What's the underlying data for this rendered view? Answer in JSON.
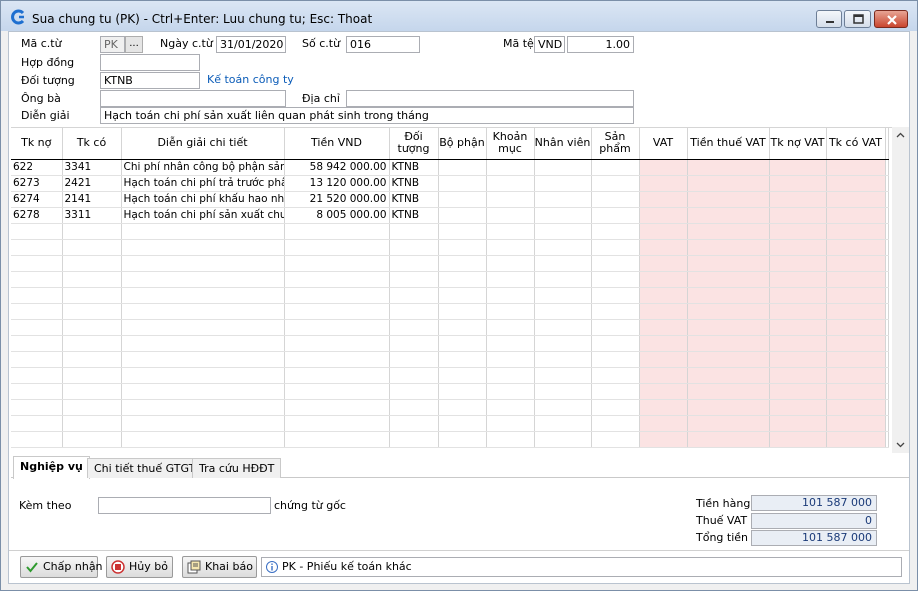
{
  "window": {
    "title": "Sua chung tu (PK) - Ctrl+Enter: Luu chung tu; Esc: Thoat"
  },
  "header": {
    "ma_ct_label": "Mã c.từ",
    "ma_ct_value": "PK",
    "ma_ct_btn": "...",
    "ngay_ct_label": "Ngày c.từ",
    "ngay_ct_value": "31/01/2020",
    "so_ct_label": "Số c.từ",
    "so_ct_value": "016",
    "ma_te_label": "Mã tệ",
    "ma_te_value": "VND",
    "ty_gia_value": "1.00",
    "hop_dong_label": "Hợp đồng",
    "hop_dong_value": "",
    "doi_tuong_label": "Đối tượng",
    "doi_tuong_value": "KTNB",
    "doi_tuong_name": "Kế toán công ty",
    "ong_ba_label": "Ông bà",
    "ong_ba_value": "",
    "dia_chi_label": "Địa chỉ",
    "dia_chi_value": "",
    "dien_giai_label": "Diễn giải",
    "dien_giai_value": "Hạch toán chi phí sản xuất liên quan phát sinh trong tháng"
  },
  "grid": {
    "columns": [
      "Tk nợ",
      "Tk có",
      "Diễn giải chi tiết",
      "Tiền VND",
      "Đối tượng",
      "Bộ phận",
      "Khoản mục",
      "Nhân viên",
      "Sản phẩm",
      "VAT",
      "Tiền thuế VAT",
      "Tk nợ VAT",
      "Tk có VAT"
    ],
    "rows": [
      [
        "622",
        "3341",
        "Chi phí nhân công bộ phận sản xu",
        "58 942 000.00",
        "KTNB",
        "",
        "",
        "",
        "",
        "",
        "",
        "",
        ""
      ],
      [
        "6273",
        "2421",
        "Hạch toán chi phí trả trước phân",
        "13 120 000.00",
        "KTNB",
        "",
        "",
        "",
        "",
        "",
        "",
        "",
        ""
      ],
      [
        "6274",
        "2141",
        "Hạch toán chi phí khấu hao nhà x",
        "21 520 000.00",
        "KTNB",
        "",
        "",
        "",
        "",
        "",
        "",
        "",
        ""
      ],
      [
        "6278",
        "3311",
        "Hạch toán chi phí sản xuất chung",
        "8 005 000.00",
        "KTNB",
        "",
        "",
        "",
        "",
        "",
        "",
        "",
        ""
      ]
    ]
  },
  "tabs": [
    "Nghiệp vụ",
    "Chi tiết thuế GTGT",
    "Tra cứu HĐĐT"
  ],
  "footer": {
    "kem_theo_label": "Kèm theo",
    "kem_theo_value": "",
    "chung_tu_goc_label": "chứng từ gốc",
    "tien_hang_label": "Tiền hàng",
    "tien_hang_value": "101 587 000",
    "thue_vat_label": "Thuế VAT",
    "thue_vat_value": "0",
    "tong_tien_label": "Tổng tiền",
    "tong_tien_value": "101 587 000"
  },
  "buttons": {
    "accept": "Chấp nhận",
    "cancel": "Hủy bỏ",
    "declare": "Khai báo"
  },
  "status": {
    "text": "PK - Phiếu kế toán khác"
  }
}
